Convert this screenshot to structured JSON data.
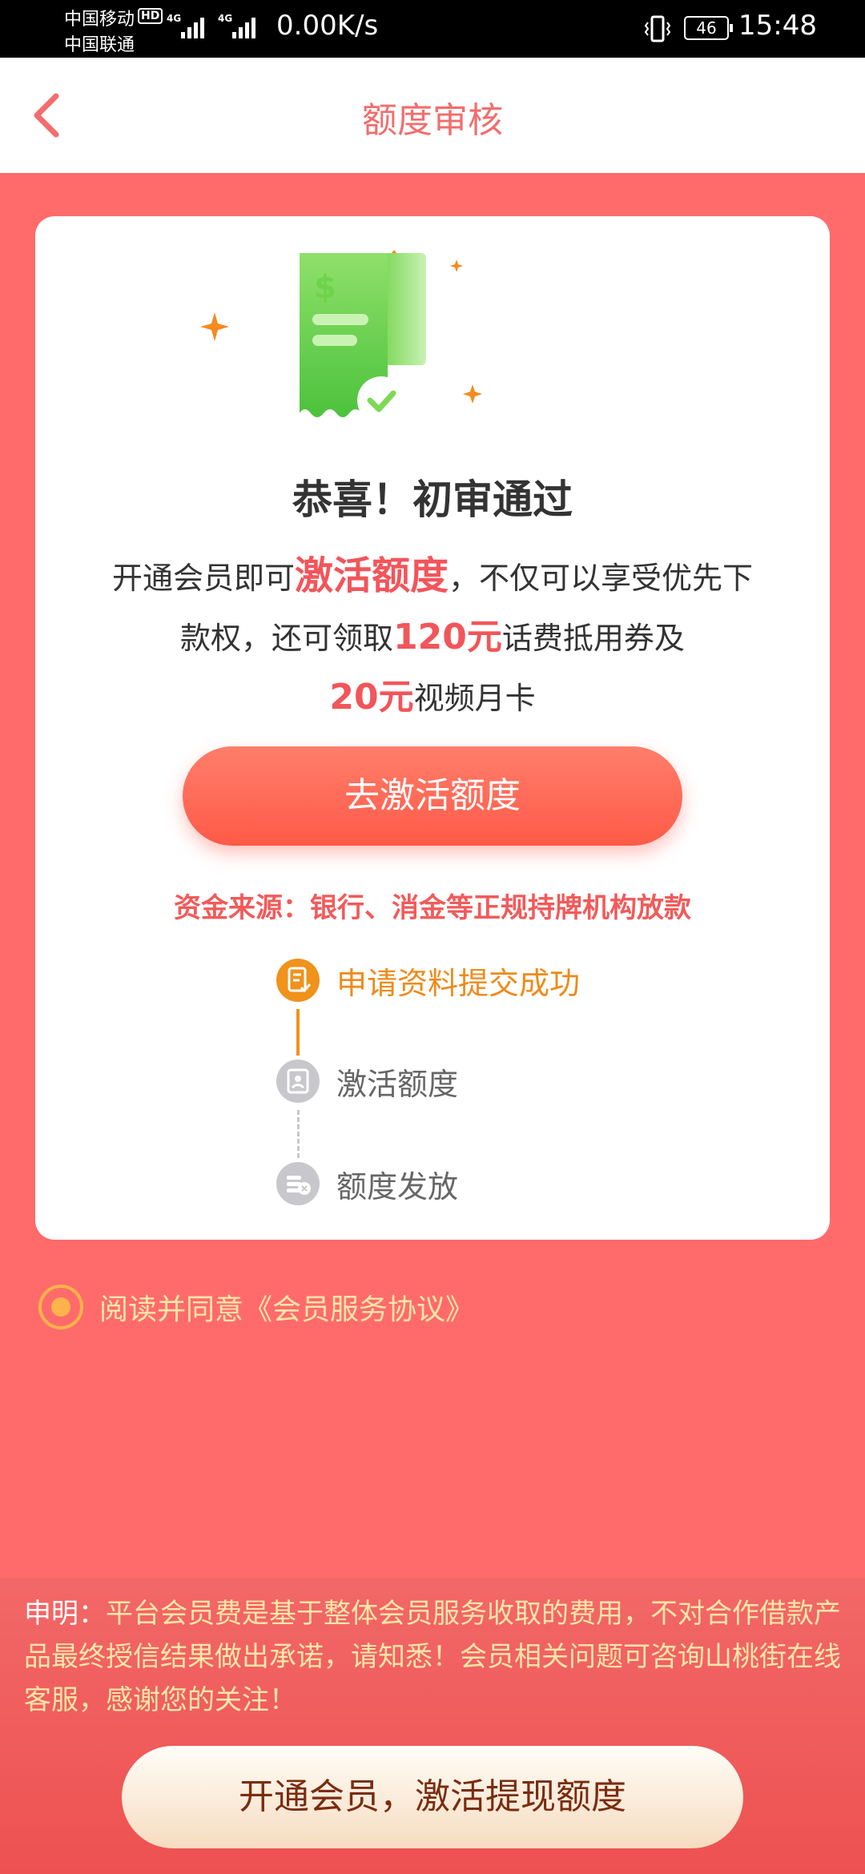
{
  "status_bar": {
    "carrier_1": "中国移动",
    "carrier_1_badge": "HD",
    "carrier_2": "中国联通",
    "signal_1_label": "4G",
    "signal_2_label": "4G",
    "net_speed": "0.00K/s",
    "battery": "46",
    "time": "15:48"
  },
  "header": {
    "title": "额度审核",
    "back_icon": "chevron-left-icon"
  },
  "card": {
    "headline": "恭喜！初审通过",
    "desc": {
      "part1": "开通会员即可",
      "highlight1": "激活额度",
      "part2": "，不仅可以享受优先下款权，还可领取",
      "highlight2": "120元",
      "part3": "话费抵用券及",
      "highlight3": "20元",
      "part4": "视频月卡"
    },
    "activate_button": "去激活额度",
    "funding_source": "资金来源：银行、消金等正规持牌机构放款",
    "steps": [
      {
        "label": "申请资料提交成功",
        "icon": "document-check-icon",
        "state": "done"
      },
      {
        "label": "激活额度",
        "icon": "id-card-icon",
        "state": "pending"
      },
      {
        "label": "额度发放",
        "icon": "coin-stack-icon",
        "state": "pending"
      }
    ]
  },
  "agreement": {
    "text": "阅读并同意《会员服务协议》",
    "checked": true
  },
  "footer": {
    "notice_label": "申明：",
    "notice_body": "平台会员费是基于整体会员服务收取的费用，不对合作借款产品最终授信结果做出承诺，请知悉！会员相关问题可咨询山桃街在线客服，感谢您的关注！",
    "open_button": "开通会员，激活提现额度"
  },
  "colors": {
    "page_bg": "#ff6b6b",
    "accent_red": "#f2555a",
    "step_done": "#ef8a1a",
    "step_pending": "#c8c8c8",
    "notice_text": "#ffe6a8"
  }
}
